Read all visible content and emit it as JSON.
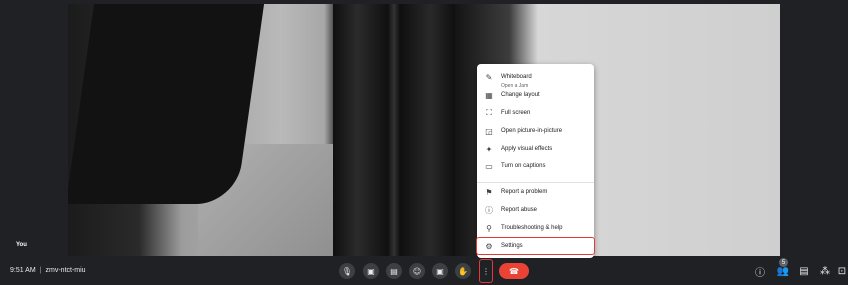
{
  "self_name": "You",
  "meeting": {
    "time": "9:51 AM",
    "code": "zmv-ntct-miu"
  },
  "controls": {
    "mic_icon": "mic-icon",
    "camera_icon": "camera-icon",
    "captions_icon": "captions-icon",
    "emoji_icon": "emoji-icon",
    "present_icon": "present-icon",
    "raise_hand_icon": "raise-hand-icon",
    "more_icon": "more-vert-icon",
    "hangup_icon": "call-end-icon"
  },
  "right_controls": {
    "participants_count": "5"
  },
  "menu": {
    "whiteboard": {
      "label": "Whiteboard",
      "sub": "Open a Jam"
    },
    "change_layout": "Change layout",
    "full_screen": "Full screen",
    "pip": "Open picture-in-picture",
    "visual_effects": "Apply visual effects",
    "captions": "Turn on captions",
    "report_problem": "Report a problem",
    "report_abuse": "Report abuse",
    "troubleshooting": "Troubleshooting & help",
    "settings": "Settings"
  },
  "colors": {
    "hangup": "#ea4335",
    "highlight": "#e53935"
  }
}
